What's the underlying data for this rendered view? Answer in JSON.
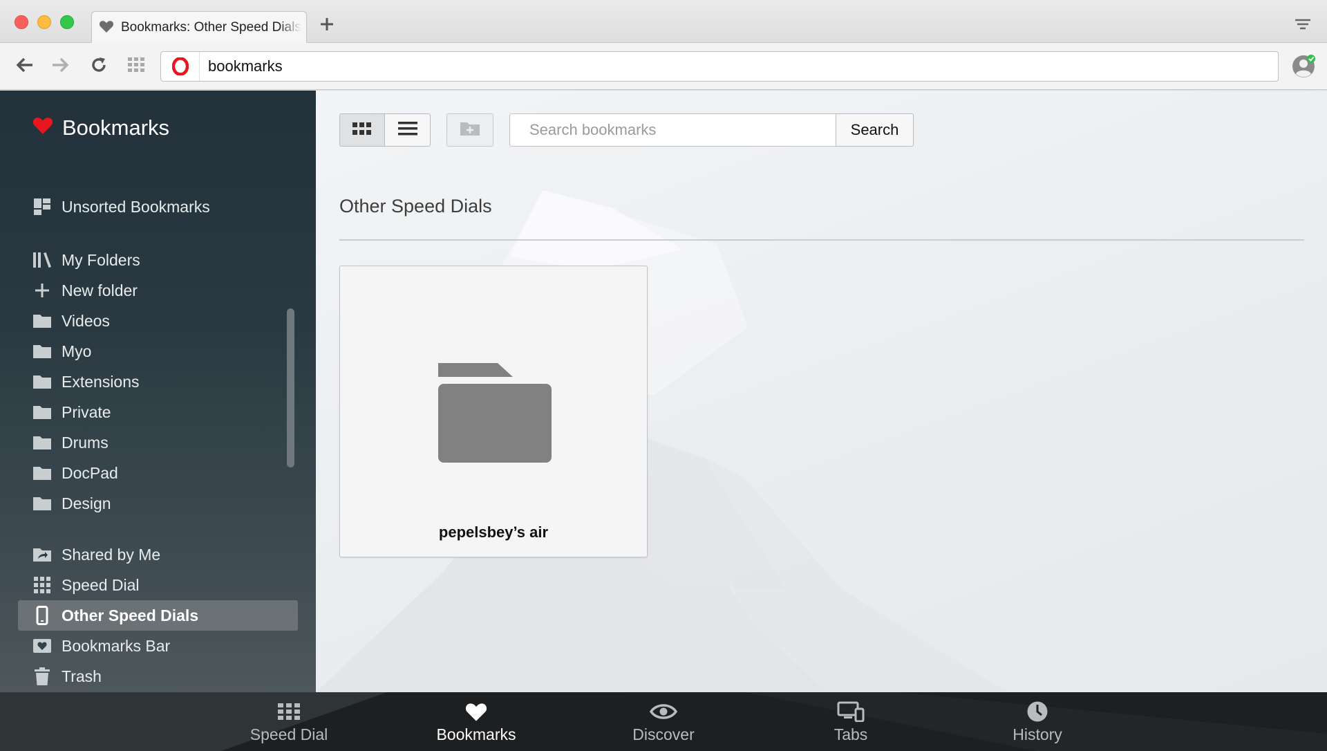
{
  "window": {
    "tab_title": "Bookmarks: Other Speed Dials",
    "tab_icon": "heart-icon",
    "address": "bookmarks"
  },
  "toolbar": {
    "back_icon": "arrow-left-icon",
    "forward_icon": "arrow-right-icon",
    "reload_icon": "reload-icon",
    "speed_dial_icon": "grid-icon",
    "browser_icon": "opera-logo-icon",
    "profile_icon": "profile-sync-icon"
  },
  "sidebar": {
    "title": "Bookmarks",
    "unsorted": "Unsorted Bookmarks",
    "my_folders": "My Folders",
    "new_folder": "New folder",
    "folders": [
      "Videos",
      "Myo",
      "Extensions",
      "Private",
      "Drums",
      "DocPad",
      "Design"
    ],
    "shared_by_me": "Shared by Me",
    "speed_dial": "Speed Dial",
    "other_speed_dials": "Other Speed Dials",
    "bookmarks_bar": "Bookmarks Bar",
    "trash": "Trash",
    "selected": "Other Speed Dials"
  },
  "main": {
    "view_mode": "grid",
    "search": {
      "placeholder": "Search bookmarks",
      "value": "",
      "button": "Search"
    },
    "section_title": "Other Speed Dials",
    "items": [
      {
        "label": "pepelsbey’s air",
        "icon": "folder-icon"
      }
    ]
  },
  "bottom_bar": {
    "items": [
      {
        "label": "Speed Dial",
        "icon": "grid-icon",
        "active": false
      },
      {
        "label": "Bookmarks",
        "icon": "heart-icon",
        "active": true
      },
      {
        "label": "Discover",
        "icon": "eye-icon",
        "active": false
      },
      {
        "label": "Tabs",
        "icon": "devices-icon",
        "active": false
      },
      {
        "label": "History",
        "icon": "clock-icon",
        "active": false
      }
    ]
  },
  "colors": {
    "accent_red": "#e8161e",
    "sidebar_bg": "#26343c",
    "sidebar_active": "#6a7275",
    "bottom_bar_bg": "#1d1f20"
  }
}
